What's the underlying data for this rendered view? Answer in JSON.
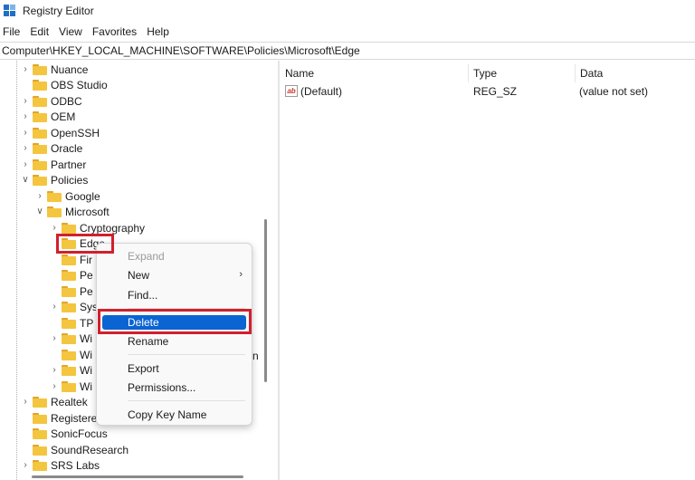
{
  "window": {
    "title": "Registry Editor"
  },
  "menu": [
    "File",
    "Edit",
    "View",
    "Favorites",
    "Help"
  ],
  "address": "Computer\\HKEY_LOCAL_MACHINE\\SOFTWARE\\Policies\\Microsoft\\Edge",
  "tree": {
    "nodes": [
      {
        "label": "Nuance",
        "chevron": ">"
      },
      {
        "label": "OBS Studio",
        "chevron": ""
      },
      {
        "label": "ODBC",
        "chevron": ">"
      },
      {
        "label": "OEM",
        "chevron": ">"
      },
      {
        "label": "OpenSSH",
        "chevron": ">"
      },
      {
        "label": "Oracle",
        "chevron": ">"
      },
      {
        "label": "Partner",
        "chevron": ">"
      },
      {
        "label": "Policies",
        "chevron": "v"
      },
      {
        "label": "Google",
        "chevron": ">"
      },
      {
        "label": "Microsoft",
        "chevron": "v"
      },
      {
        "label": "Cryptography",
        "chevron": ">"
      },
      {
        "label": "Edge",
        "chevron": ""
      },
      {
        "label": "Fir",
        "chevron": ""
      },
      {
        "label": "Pe",
        "chevron": ""
      },
      {
        "label": "Pe",
        "chevron": ""
      },
      {
        "label": "Sys",
        "chevron": ">"
      },
      {
        "label": "TP",
        "chevron": ""
      },
      {
        "label": "Wi",
        "chevron": ">"
      },
      {
        "label": "Wi",
        "chevron": ""
      },
      {
        "label": "Wi",
        "chevron": ">"
      },
      {
        "label": "Wi",
        "chevron": ">"
      },
      {
        "label": "Realtek",
        "chevron": ">"
      },
      {
        "label": "RegisteredApplications",
        "chevron": ""
      },
      {
        "label": "SonicFocus",
        "chevron": ""
      },
      {
        "label": "SoundResearch",
        "chevron": ""
      },
      {
        "label": "SRS Labs",
        "chevron": ">"
      }
    ],
    "cut_off_suffix": "n"
  },
  "values": {
    "columns": [
      "Name",
      "Type",
      "Data"
    ],
    "rows": [
      {
        "name": "(Default)",
        "type": "REG_SZ",
        "data": "(value not set)"
      }
    ]
  },
  "context_menu": {
    "items": [
      {
        "label": "Expand",
        "disabled": true
      },
      {
        "label": "New",
        "submenu": true
      },
      {
        "label": "Find..."
      },
      {
        "label": "Delete",
        "selected": true
      },
      {
        "label": "Rename"
      },
      {
        "label": "Export"
      },
      {
        "label": "Permissions..."
      },
      {
        "label": "Copy Key Name"
      }
    ],
    "submenu_arrow": ">"
  },
  "colors": {
    "highlight_box": "#d0202e",
    "selection": "#0a64d2",
    "folder": "#f4c53f"
  },
  "icons": {
    "app": "registry-editor-icon",
    "folder": "folder-icon",
    "string_value": "string-value-icon"
  }
}
